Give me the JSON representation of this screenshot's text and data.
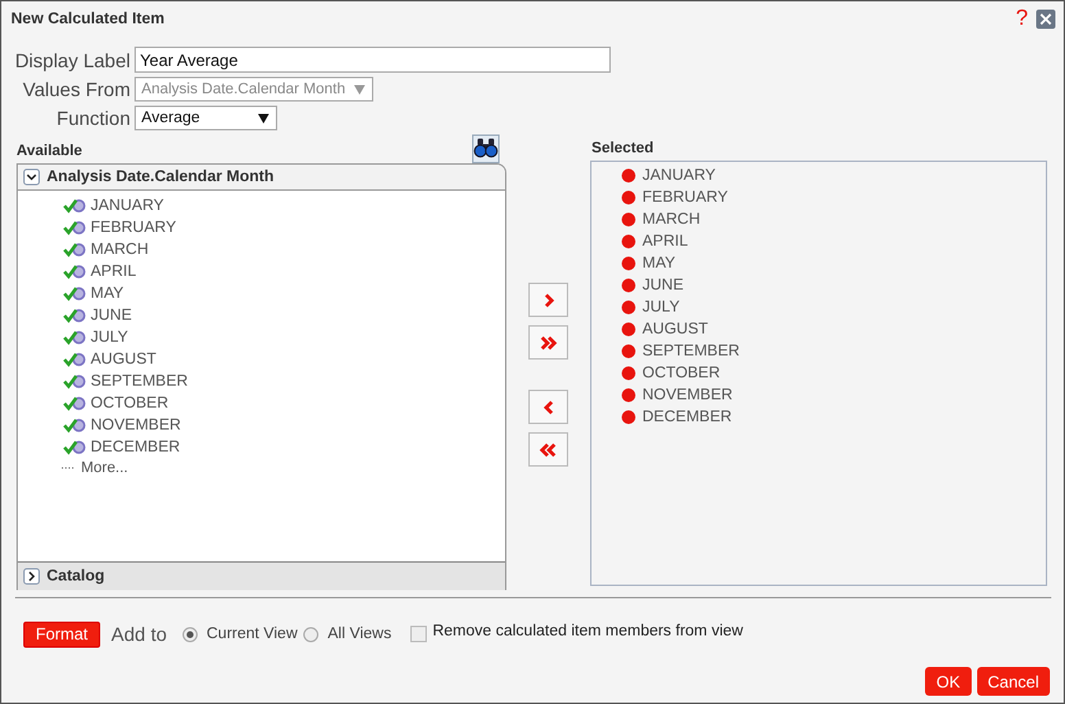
{
  "window": {
    "title": "New Calculated Item",
    "help": "?"
  },
  "form": {
    "display_label": {
      "label": "Display Label",
      "value": "Year Average"
    },
    "values_from": {
      "label": "Values From",
      "value": "Analysis Date.Calendar Month",
      "disabled": true
    },
    "function": {
      "label": "Function",
      "value": "Average"
    }
  },
  "available": {
    "title": "Available",
    "groups": [
      {
        "name": "Analysis Date.Calendar Month",
        "expanded": true,
        "items": [
          "JANUARY",
          "FEBRUARY",
          "MARCH",
          "APRIL",
          "MAY",
          "JUNE",
          "JULY",
          "AUGUST",
          "SEPTEMBER",
          "OCTOBER",
          "NOVEMBER",
          "DECEMBER"
        ],
        "more": "More..."
      },
      {
        "name": "Catalog",
        "expanded": false
      }
    ]
  },
  "selected": {
    "title": "Selected",
    "items": [
      "JANUARY",
      "FEBRUARY",
      "MARCH",
      "APRIL",
      "MAY",
      "JUNE",
      "JULY",
      "AUGUST",
      "SEPTEMBER",
      "OCTOBER",
      "NOVEMBER",
      "DECEMBER"
    ]
  },
  "footer": {
    "format_button": "Format",
    "add_to_label": "Add to",
    "add_to_options": [
      {
        "label": "Current View",
        "selected": true
      },
      {
        "label": "All Views",
        "selected": false
      }
    ],
    "remove_members": {
      "label": "Remove calculated item members from view",
      "checked": false
    }
  },
  "buttons": [
    {
      "label": "OK"
    },
    {
      "label": "Cancel"
    }
  ]
}
